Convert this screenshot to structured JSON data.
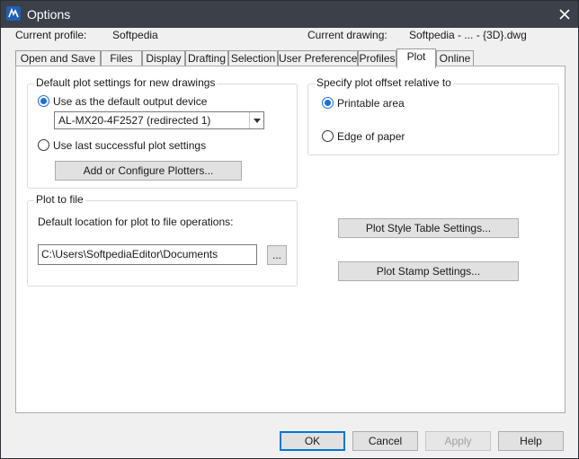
{
  "window": {
    "title": "Options",
    "close_icon": "close-icon",
    "app_icon": "autocad-icon"
  },
  "info": {
    "current_profile_label": "Current profile:",
    "current_profile_value": "Softpedia",
    "current_drawing_label": "Current drawing:",
    "current_drawing_value": "Softpedia - ... - {3D}.dwg"
  },
  "tabs": [
    {
      "label": "Open and Save"
    },
    {
      "label": "Files"
    },
    {
      "label": "Display"
    },
    {
      "label": "Drafting"
    },
    {
      "label": "Selection"
    },
    {
      "label": "User Preferences"
    },
    {
      "label": "Profiles"
    },
    {
      "label": "Plot",
      "active": true
    },
    {
      "label": "Online"
    }
  ],
  "plot_settings": {
    "title": "Default plot settings for new drawings",
    "default_device_label": "Use as the default output device",
    "device_value": "AL-MX20-4F2527 (redirected 1)",
    "last_successful_label": "Use last successful plot settings",
    "add_configure_button": "Add or Configure Plotters..."
  },
  "plot_offset": {
    "title": "Specify plot offset relative to",
    "printable_area_label": "Printable area",
    "edge_of_paper_label": "Edge of paper"
  },
  "plot_to_file": {
    "title": "Plot to file",
    "location_label": "Default location for plot to file operations:",
    "location_value": "C:\\Users\\SoftpediaEditor\\Documents",
    "browse_button": "..."
  },
  "side_buttons": {
    "style_table": "Plot Style Table Settings...",
    "stamp": "Plot Stamp Settings..."
  },
  "footer": {
    "ok": "OK",
    "cancel": "Cancel",
    "apply": "Apply",
    "help": "Help"
  },
  "colors": {
    "titlebar": "#3b4049",
    "accent": "#1a6fd6",
    "default_border": "#0078d7"
  }
}
